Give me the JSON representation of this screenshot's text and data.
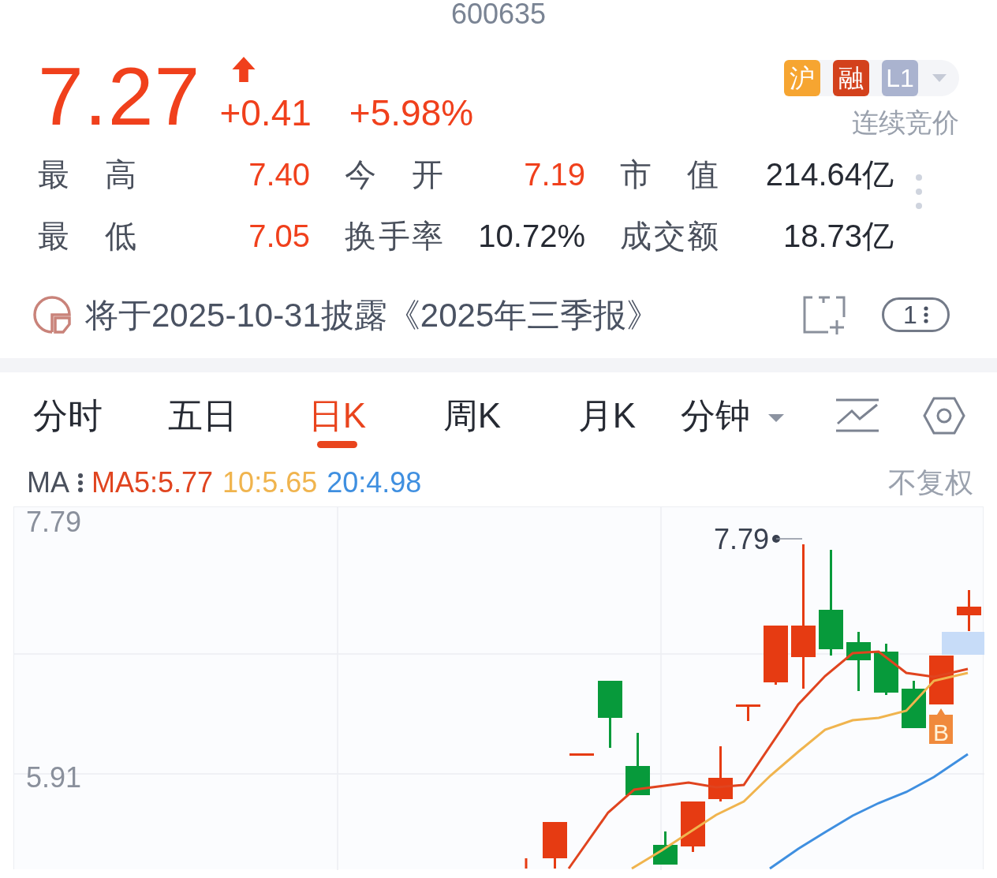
{
  "header": {
    "code": "600635"
  },
  "quote": {
    "price": "7.27",
    "rising": true,
    "change": "+0.41",
    "change_pct": "+5.98%"
  },
  "badges": [
    {
      "label": "沪",
      "color": "#f6a531"
    },
    {
      "label": "融",
      "color": "#d3411c"
    },
    {
      "label": "L1",
      "color": "#aab3cf"
    }
  ],
  "trading_status": "连续竞价",
  "stats": [
    {
      "label": "最 高",
      "value": "7.40",
      "color": "#f0401c"
    },
    {
      "label": "今 开",
      "value": "7.19",
      "color": "#f0401c"
    },
    {
      "label": "市 值",
      "value": "214.64亿",
      "color": "#262a33"
    },
    {
      "label": "最 低",
      "value": "7.05",
      "color": "#f0401c"
    },
    {
      "label": "换手率",
      "value": "10.72%",
      "color": "#262a33"
    },
    {
      "label": "成交额",
      "value": "18.73亿",
      "color": "#262a33"
    }
  ],
  "notice": {
    "text": "将于2025-10-31披露《2025年三季报》",
    "counter": "1"
  },
  "tabs": [
    {
      "label": "分时",
      "selected": false,
      "kind": "plain"
    },
    {
      "label": "五日",
      "selected": false,
      "kind": "plain"
    },
    {
      "label": "日K",
      "selected": true,
      "kind": "plain"
    },
    {
      "label": "周K",
      "selected": false,
      "kind": "plain"
    },
    {
      "label": "月K",
      "selected": false,
      "kind": "plain"
    },
    {
      "label": "分钟",
      "selected": false,
      "kind": "dropdown"
    }
  ],
  "ma_legend": {
    "label": "MA",
    "items": [
      {
        "text": "MA5:5.77",
        "color": "#e0441f"
      },
      {
        "text": "10:5.65",
        "color": "#f0b44e"
      },
      {
        "text": "20:4.98",
        "color": "#3f8fe0"
      }
    ],
    "adjust": "不复权"
  },
  "chart": {
    "y_labels": [
      "7.79",
      "5.91"
    ],
    "max_label": "7.79",
    "buy_marker": "B"
  }
}
